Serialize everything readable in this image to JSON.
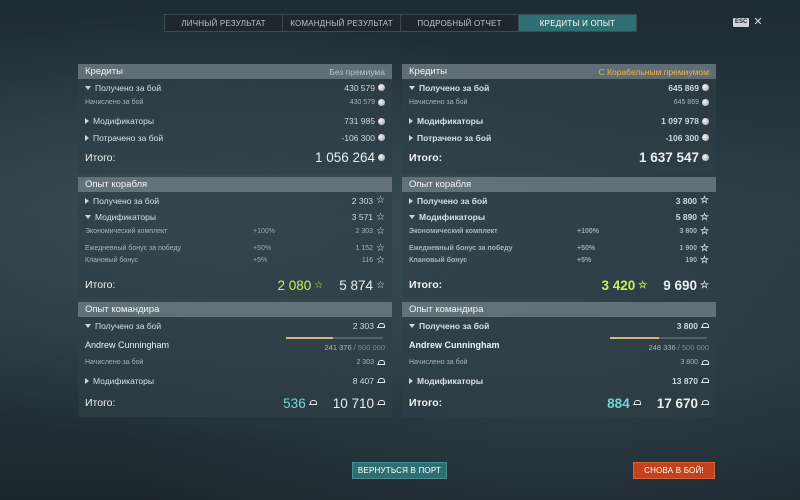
{
  "tabs": [
    "ЛИЧНЫЙ РЕЗУЛЬТАТ",
    "КОМАНДНЫЙ РЕЗУЛЬТАТ",
    "ПОДРОБНЫЙ ОТЧЕТ",
    "КРЕДИТЫ И ОПЫТ"
  ],
  "active_tab": "КРЕДИТЫ И ОПЫТ",
  "esc": {
    "key": "ESC",
    "close": "✕"
  },
  "left": {
    "credits": {
      "title": "Кредиты",
      "premium": "Без премиума",
      "received": {
        "label": "Получено за бой",
        "value": "430 579"
      },
      "accrued": {
        "label": "Начислено за бой",
        "value": "430 579"
      },
      "modifiers": {
        "label": "Модификаторы",
        "value": "731 985"
      },
      "spent": {
        "label": "Потрачено за бой",
        "value": "-106 300"
      },
      "total": {
        "label": "Итого:",
        "value": "1 056 264"
      }
    },
    "ship_xp": {
      "title": "Опыт корабля",
      "received": {
        "label": "Получено за бой",
        "value": "2 303"
      },
      "modifiers": {
        "label": "Модификаторы",
        "value": "3 571"
      },
      "economic": {
        "label": "Экономический комплект",
        "pct": "+100%",
        "value": "2 303"
      },
      "daily": {
        "label": "Ежедневный бонус за победу",
        "pct": "+50%",
        "value": "1 152"
      },
      "clan": {
        "label": "Клановый бонус",
        "pct": "+5%",
        "value": "116"
      },
      "total": {
        "label": "Итого:",
        "free": "2 080",
        "value": "5 874"
      }
    },
    "commander_xp": {
      "title": "Опыт командира",
      "received": {
        "label": "Получено за бой",
        "value": "2 303"
      },
      "commander": {
        "name": "Andrew Cunningham",
        "current": "241 376",
        "max": "/ 500 000",
        "progress": 0.48
      },
      "accrued": {
        "label": "Начислено за бой",
        "value": "2 303"
      },
      "modifiers": {
        "label": "Модификаторы",
        "value": "8 407"
      },
      "total": {
        "label": "Итого:",
        "elite": "536",
        "value": "10 710"
      }
    }
  },
  "right": {
    "credits": {
      "title": "Кредиты",
      "premium": "С Корабельным премиумом",
      "received": {
        "label": "Получено за бой",
        "value": "645 869"
      },
      "accrued": {
        "label": "Начислено за бой",
        "value": "645 869"
      },
      "modifiers": {
        "label": "Модификаторы",
        "value": "1 097 978"
      },
      "spent": {
        "label": "Потрачено за бой",
        "value": "-106 300"
      },
      "total": {
        "label": "Итого:",
        "value": "1 637 547"
      }
    },
    "ship_xp": {
      "title": "Опыт корабля",
      "received": {
        "label": "Получено за бой",
        "value": "3 800"
      },
      "modifiers": {
        "label": "Модификаторы",
        "value": "5 890"
      },
      "economic": {
        "label": "Экономический комплект",
        "pct": "+100%",
        "value": "3 800"
      },
      "daily": {
        "label": "Ежедневный бонус за победу",
        "pct": "+50%",
        "value": "1 900"
      },
      "clan": {
        "label": "Клановый бонус",
        "pct": "+5%",
        "value": "190"
      },
      "total": {
        "label": "Итого:",
        "free": "3 420",
        "value": "9 690"
      }
    },
    "commander_xp": {
      "title": "Опыт командира",
      "received": {
        "label": "Получено за бой",
        "value": "3 800"
      },
      "commander": {
        "name": "Andrew Cunningham",
        "current": "248 336",
        "max": "/ 500 000",
        "progress": 0.5
      },
      "accrued": {
        "label": "Начислено за бой",
        "value": "3 800"
      },
      "modifiers": {
        "label": "Модификаторы",
        "value": "13 870"
      },
      "total": {
        "label": "Итого:",
        "elite": "884",
        "value": "17 670"
      }
    }
  },
  "buttons": {
    "port": "ВЕРНУТЬСЯ В ПОРТ",
    "battle": "СНОВА В БОЙ!"
  }
}
